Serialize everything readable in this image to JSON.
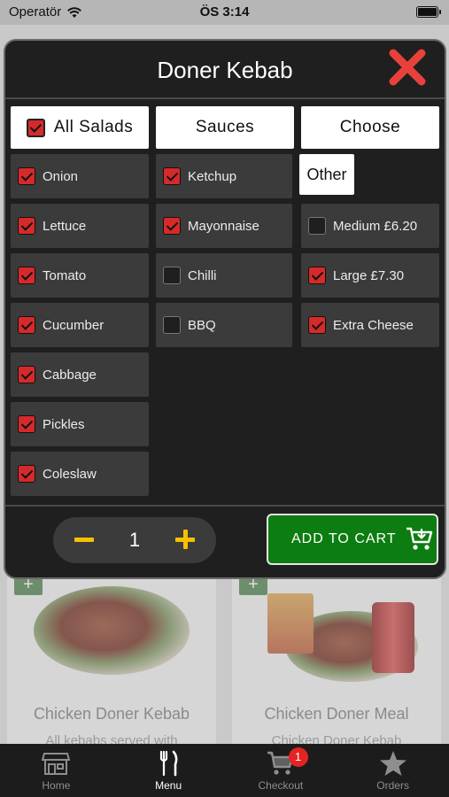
{
  "status_bar": {
    "carrier": "Operatör",
    "time": "ÖS 3:14"
  },
  "modal": {
    "title": "Doner Kebab",
    "columns": {
      "salads": {
        "header": "All Salads",
        "header_checked": true
      },
      "sauces": {
        "header": "Sauces"
      },
      "choose": {
        "header": "Choose"
      }
    },
    "salads": [
      {
        "label": "Onion",
        "checked": true
      },
      {
        "label": "Lettuce",
        "checked": true
      },
      {
        "label": "Tomato",
        "checked": true
      },
      {
        "label": "Cucumber",
        "checked": true
      },
      {
        "label": "Cabbage",
        "checked": true
      },
      {
        "label": "Pickles",
        "checked": true
      },
      {
        "label": "Coleslaw",
        "checked": true
      }
    ],
    "sauces": [
      {
        "label": "Ketchup",
        "checked": true
      },
      {
        "label": "Mayonnaise",
        "checked": true
      },
      {
        "label": "Chilli",
        "checked": false
      },
      {
        "label": "BBQ",
        "checked": false
      }
    ],
    "other_label": "Other",
    "choose": [
      {
        "label": "Medium £6.20",
        "checked": false
      },
      {
        "label": "Large £7.30",
        "checked": true
      },
      {
        "label": "Extra Cheese",
        "checked": true
      }
    ],
    "quantity": "1",
    "add_to_cart_label": "ADD TO CART"
  },
  "background": {
    "cards": [
      {
        "title": "Chicken Doner Kebab",
        "subtitle": "All kebabs served with"
      },
      {
        "title": "Chicken Doner Meal",
        "subtitle": "Chicken Doner Kebab"
      }
    ]
  },
  "tabbar": {
    "tabs": [
      {
        "label": "Home",
        "icon": "store-icon",
        "active": false
      },
      {
        "label": "Menu",
        "icon": "fork-knife-icon",
        "active": true
      },
      {
        "label": "Checkout",
        "icon": "cart-icon",
        "active": false,
        "badge": "1"
      },
      {
        "label": "Orders",
        "icon": "star-icon",
        "active": false
      }
    ]
  },
  "colors": {
    "accent_red": "#d62a2a",
    "cart_green": "#0c7d10",
    "stepper_yellow": "#f4c000",
    "modal_bg": "#1f1f1f"
  }
}
